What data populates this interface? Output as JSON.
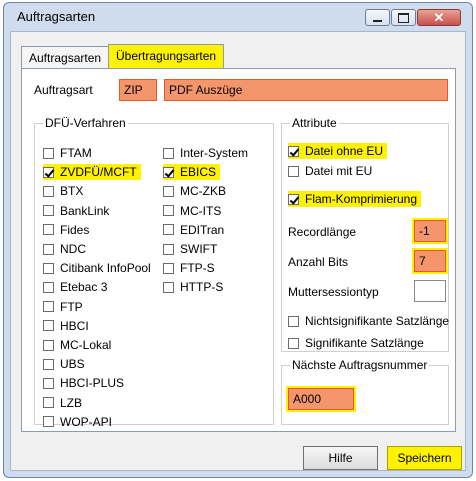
{
  "window": {
    "title": "Auftragsarten"
  },
  "tabs": [
    {
      "label": "Auftragsarten"
    },
    {
      "label": "Übertragungsarten"
    }
  ],
  "auftragsart": {
    "label": "Auftragsart",
    "code": "ZIP",
    "description": "PDF Auszüge"
  },
  "dfue": {
    "title": "DFÜ-Verfahren",
    "col1": [
      {
        "label": "FTAM",
        "checked": false
      },
      {
        "label": "ZVDFÜ/MCFT",
        "checked": true
      },
      {
        "label": "BTX",
        "checked": false
      },
      {
        "label": "BankLink",
        "checked": false
      },
      {
        "label": "Fides",
        "checked": false
      },
      {
        "label": "NDC",
        "checked": false
      },
      {
        "label": "Citibank InfoPool",
        "checked": false
      },
      {
        "label": "Etebac 3",
        "checked": false
      },
      {
        "label": "FTP",
        "checked": false
      },
      {
        "label": "HBCI",
        "checked": false
      },
      {
        "label": "MC-Lokal",
        "checked": false
      },
      {
        "label": "UBS",
        "checked": false
      },
      {
        "label": "HBCI-PLUS",
        "checked": false
      },
      {
        "label": "LZB",
        "checked": false
      },
      {
        "label": "WOP-API",
        "checked": false
      }
    ],
    "col2": [
      {
        "label": "Inter-System",
        "checked": false
      },
      {
        "label": "EBICS",
        "checked": true
      },
      {
        "label": "MC-ZKB",
        "checked": false
      },
      {
        "label": "MC-ITS",
        "checked": false
      },
      {
        "label": "EDITran",
        "checked": false
      },
      {
        "label": "SWIFT",
        "checked": false
      },
      {
        "label": "FTP-S",
        "checked": false
      },
      {
        "label": "HTTP-S",
        "checked": false
      }
    ]
  },
  "attribute": {
    "title": "Attribute",
    "datei_ohne_eu": "Datei ohne EU",
    "datei_mit_eu": "Datei mit EU",
    "flam": "Flam-Komprimierung",
    "recordlaenge_label": "Recordlänge",
    "recordlaenge_value": "-1",
    "anzahl_bits_label": "Anzahl Bits",
    "anzahl_bits_value": "7",
    "muttersession_label": "Muttersessiontyp",
    "muttersession_value": "",
    "nicht_signifikant": "Nichtsignifikante Satzlänge",
    "signifikant": "Signifikante Satzlänge"
  },
  "naechste": {
    "title": "Nächste Auftragsnummer",
    "value": "A000"
  },
  "buttons": {
    "hilfe": "Hilfe",
    "speichern": "Speichern"
  },
  "colors": {
    "highlight": "#fff200",
    "field_orange": "#f4956b",
    "window_frame": "#cfdcee"
  }
}
